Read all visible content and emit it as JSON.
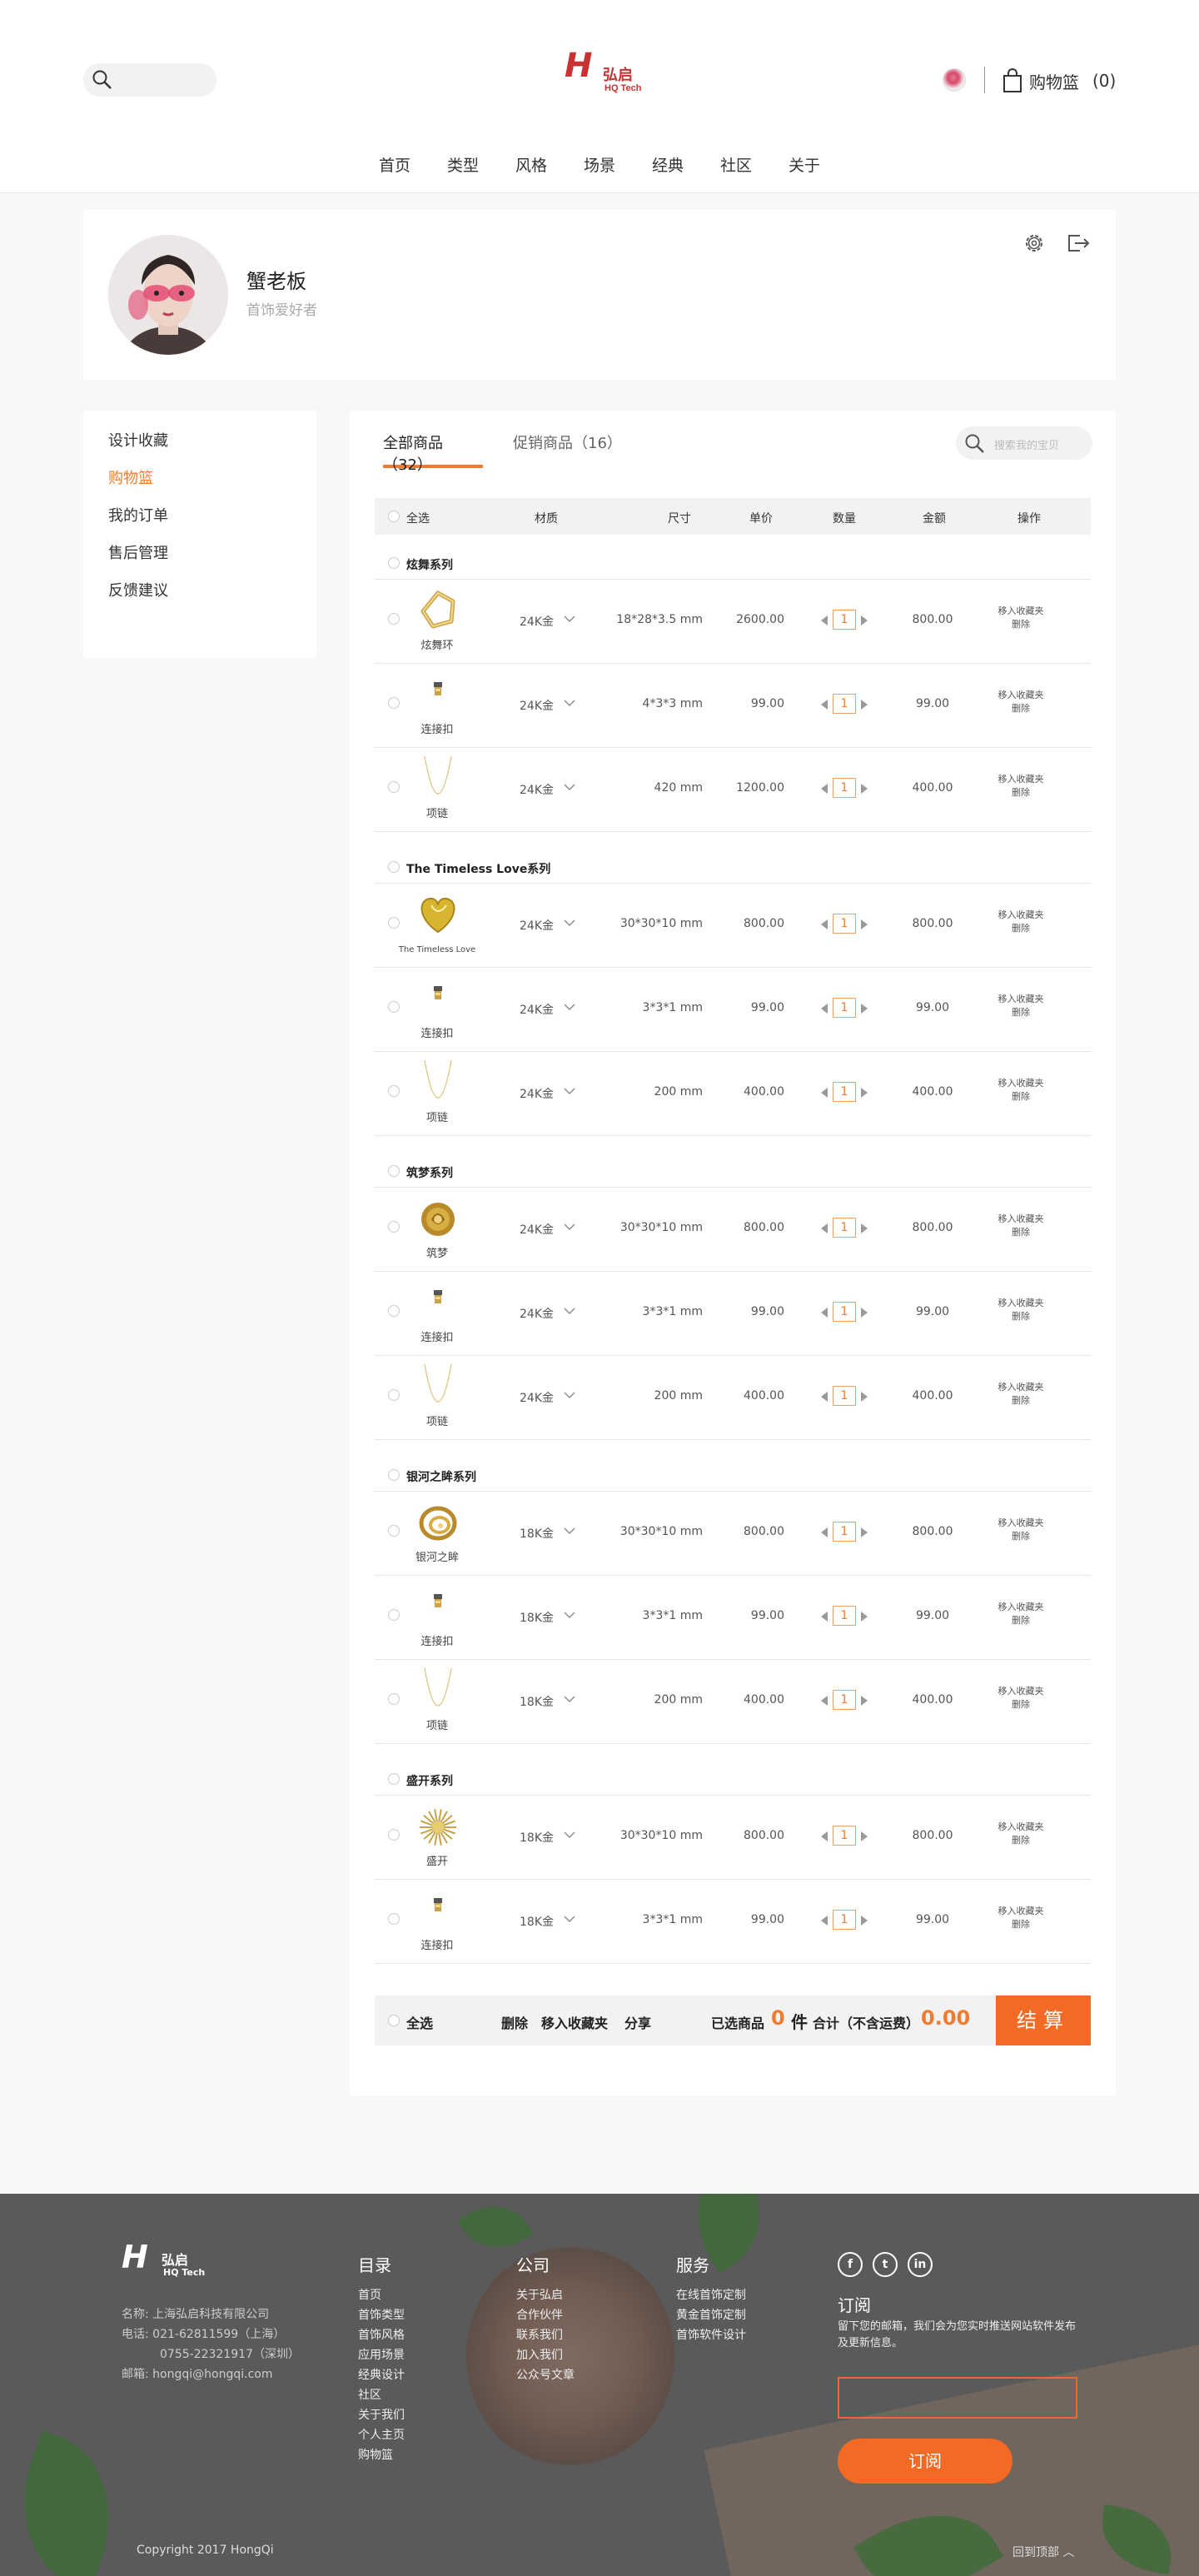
{
  "header": {
    "logo_cn": "弘启",
    "logo_en": "HQ Tech",
    "cart_label": "购物篮",
    "cart_count": "(0)"
  },
  "nav": [
    "首页",
    "类型",
    "风格",
    "场景",
    "经典",
    "社区",
    "关于"
  ],
  "profile": {
    "name": "蟹老板",
    "bio": "首饰爱好者"
  },
  "sidebar": {
    "items": [
      "设计收藏",
      "购物篮",
      "我的订单",
      "售后管理",
      "反馈建议"
    ],
    "active_index": 1
  },
  "tabs": {
    "all": "全部商品（32）",
    "promo": "促销商品（16）"
  },
  "item_search_placeholder": "搜索我的宝贝",
  "table_headers": {
    "select_all": "全选",
    "material": "材质",
    "size": "尺寸",
    "unit_price": "单价",
    "quantity": "数量",
    "amount": "金额",
    "actions": "操作"
  },
  "row_actions": {
    "move": "移入收藏夹",
    "delete": "删除"
  },
  "series": [
    {
      "title": "炫舞系列",
      "items": [
        {
          "name": "炫舞环",
          "material": "24K金",
          "size": "18*28*3.5 mm",
          "price": "2600.00",
          "qty": "1",
          "amount": "800.00",
          "thumb": "ring-icon"
        },
        {
          "name": "连接扣",
          "material": "24K金",
          "size": "4*3*3 mm",
          "price": "99.00",
          "qty": "1",
          "amount": "99.00",
          "thumb": "clasp-icon"
        },
        {
          "name": "项链",
          "material": "24K金",
          "size": "420 mm",
          "price": "1200.00",
          "qty": "1",
          "amount": "400.00",
          "thumb": "necklace-icon"
        }
      ]
    },
    {
      "title": "The Timeless Love系列",
      "items": [
        {
          "name": "The Timeless Love",
          "material": "24K金",
          "size": "30*30*10 mm",
          "price": "800.00",
          "qty": "1",
          "amount": "800.00",
          "thumb": "heart-pendant-icon"
        },
        {
          "name": "连接扣",
          "material": "24K金",
          "size": "3*3*1 mm",
          "price": "99.00",
          "qty": "1",
          "amount": "99.00",
          "thumb": "clasp-icon"
        },
        {
          "name": "项链",
          "material": "24K金",
          "size": "200 mm",
          "price": "400.00",
          "qty": "1",
          "amount": "400.00",
          "thumb": "necklace-icon"
        }
      ]
    },
    {
      "title": "筑梦系列",
      "items": [
        {
          "name": "筑梦",
          "material": "24K金",
          "size": "30*30*10 mm",
          "price": "800.00",
          "qty": "1",
          "amount": "800.00",
          "thumb": "rose-pendant-icon"
        },
        {
          "name": "连接扣",
          "material": "24K金",
          "size": "3*3*1 mm",
          "price": "99.00",
          "qty": "1",
          "amount": "99.00",
          "thumb": "clasp-icon"
        },
        {
          "name": "项链",
          "material": "24K金",
          "size": "200 mm",
          "price": "400.00",
          "qty": "1",
          "amount": "400.00",
          "thumb": "necklace-icon"
        }
      ]
    },
    {
      "title": "银河之眸系列",
      "items": [
        {
          "name": "银河之眸",
          "material": "18K金",
          "size": "30*30*10 mm",
          "price": "800.00",
          "qty": "1",
          "amount": "800.00",
          "thumb": "orbit-pendant-icon"
        },
        {
          "name": "连接扣",
          "material": "18K金",
          "size": "3*3*1 mm",
          "price": "99.00",
          "qty": "1",
          "amount": "99.00",
          "thumb": "clasp-icon"
        },
        {
          "name": "项链",
          "material": "18K金",
          "size": "200 mm",
          "price": "400.00",
          "qty": "1",
          "amount": "400.00",
          "thumb": "necklace-icon"
        }
      ]
    },
    {
      "title": "盛开系列",
      "items": [
        {
          "name": "盛开",
          "material": "18K金",
          "size": "30*30*10 mm",
          "price": "800.00",
          "qty": "1",
          "amount": "800.00",
          "thumb": "bloom-pendant-icon"
        },
        {
          "name": "连接扣",
          "material": "18K金",
          "size": "3*3*1 mm",
          "price": "99.00",
          "qty": "1",
          "amount": "99.00",
          "thumb": "clasp-icon"
        }
      ]
    }
  ],
  "summary": {
    "select_all": "全选",
    "delete": "删除",
    "move": "移入收藏夹",
    "share": "分享",
    "selected_label": "已选商品",
    "selected_count": "0",
    "unit": "件",
    "total_label": "合计（不含运费）",
    "total": "0.00",
    "checkout": "结算"
  },
  "footer": {
    "company_name": "名称:  上海弘启科技有限公司",
    "phone1": "电话:  021-62811599（上海）",
    "phone2": "0755-22321917（深圳）",
    "email": "邮箱:  hongqi@hongqi.com",
    "col1_title": "目录",
    "col1_items": [
      "首页",
      "首饰类型",
      "首饰风格",
      "应用场景",
      "经典设计",
      "社区",
      "关于我们",
      "个人主页",
      "购物篮"
    ],
    "col2_title": "公司",
    "col2_items": [
      "关于弘启",
      "合作伙伴",
      "联系我们",
      "加入我们",
      "公众号文章"
    ],
    "col3_title": "服务",
    "col3_items": [
      "在线首饰定制",
      "黄金首饰定制",
      "首饰软件设计"
    ],
    "subscribe_title": "订阅",
    "subscribe_desc": "留下您的邮箱，我们会为您实时推送网站软件发布及更新信息。",
    "subscribe_button": "订阅",
    "copyright": "Copyright 2017 HongQi",
    "back_to_top": "回到顶部 ︿"
  },
  "colors": {
    "accent": "#f07c34",
    "checkout": "#f26a24",
    "brand": "#c83232"
  }
}
